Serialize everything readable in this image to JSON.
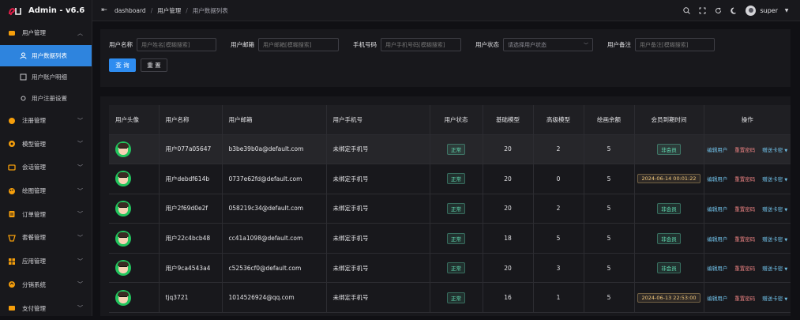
{
  "app": {
    "title": "Admin - v6.6",
    "accent": "#2e84de"
  },
  "sidebar": {
    "groups": [
      {
        "label": "用户管理",
        "icon": "user-group-icon",
        "color": "#f59e0b",
        "expanded": true
      },
      {
        "label": "注册管理",
        "icon": "register-icon",
        "color": "#f59e0b"
      },
      {
        "label": "模型管理",
        "icon": "model-icon",
        "color": "#f59e0b"
      },
      {
        "label": "会话管理",
        "icon": "chat-icon",
        "color": "#f59e0b"
      },
      {
        "label": "绘图管理",
        "icon": "palette-icon",
        "color": "#f59e0b"
      },
      {
        "label": "订单管理",
        "icon": "order-icon",
        "color": "#f59e0b"
      },
      {
        "label": "套餐管理",
        "icon": "package-icon",
        "color": "#f59e0b"
      },
      {
        "label": "应用管理",
        "icon": "apps-icon",
        "color": "#f59e0b"
      },
      {
        "label": "分销系统",
        "icon": "distribution-icon",
        "color": "#f59e0b"
      },
      {
        "label": "支付管理",
        "icon": "payment-icon",
        "color": "#f59e0b"
      }
    ],
    "sub_items": [
      {
        "label": "用户数据列表",
        "icon": "person-icon",
        "active": true
      },
      {
        "label": "用户账户明细",
        "icon": "ledger-icon"
      },
      {
        "label": "用户注册设置",
        "icon": "settings-icon"
      }
    ]
  },
  "header": {
    "breadcrumb": [
      "dashboard",
      "用户管理",
      "用户数据列表"
    ],
    "separator": "/",
    "username": "super"
  },
  "search": {
    "fields": [
      {
        "label": "用户名称",
        "placeholder": "用户姓名[模糊搜索]"
      },
      {
        "label": "用户邮箱",
        "placeholder": "用户邮箱[模糊搜索]"
      },
      {
        "label": "手机号码",
        "placeholder": "用户手机号码[模糊搜索]"
      },
      {
        "label": "用户状态",
        "placeholder": "请选择用户状态"
      },
      {
        "label": "用户备注",
        "placeholder": "用户备注[模糊搜索]"
      }
    ],
    "query_label": "查 询",
    "reset_label": "重 置"
  },
  "table": {
    "headers": [
      "用户头像",
      "用户名称",
      "用户邮箱",
      "用户手机号",
      "用户状态",
      "基础模型",
      "高级模型",
      "绘画余额",
      "会员到期时间",
      "操作"
    ],
    "actions": {
      "edit": "编辑用户",
      "reset": "重置密码",
      "gift": "赠送卡密"
    },
    "rows": [
      {
        "name": "用户077a05647",
        "email": "b3be39b0a@default.com",
        "phone": "未绑定手机号",
        "status": "正常",
        "basic": "20",
        "advanced": "2",
        "draw": "5",
        "expiry": "非会员",
        "member": false
      },
      {
        "name": "用户debdf614b",
        "email": "0737e62fd@default.com",
        "phone": "未绑定手机号",
        "status": "正常",
        "basic": "20",
        "advanced": "0",
        "draw": "5",
        "expiry": "2024-06-14 00:01:22",
        "member": true
      },
      {
        "name": "用户2f69d0e2f",
        "email": "058219c34@default.com",
        "phone": "未绑定手机号",
        "status": "正常",
        "basic": "20",
        "advanced": "2",
        "draw": "5",
        "expiry": "非会员",
        "member": false
      },
      {
        "name": "用户22c4bcb48",
        "email": "cc41a1098@default.com",
        "phone": "未绑定手机号",
        "status": "正常",
        "basic": "18",
        "advanced": "5",
        "draw": "5",
        "expiry": "非会员",
        "member": false
      },
      {
        "name": "用户9ca4543a4",
        "email": "c52536cf0@default.com",
        "phone": "未绑定手机号",
        "status": "正常",
        "basic": "20",
        "advanced": "3",
        "draw": "5",
        "expiry": "非会员",
        "member": false
      },
      {
        "name": "tjq3721",
        "email": "1014526924@qq.com",
        "phone": "未绑定手机号",
        "status": "正常",
        "basic": "16",
        "advanced": "1",
        "draw": "5",
        "expiry": "2024-06-13 22:53:00",
        "member": true
      }
    ]
  }
}
